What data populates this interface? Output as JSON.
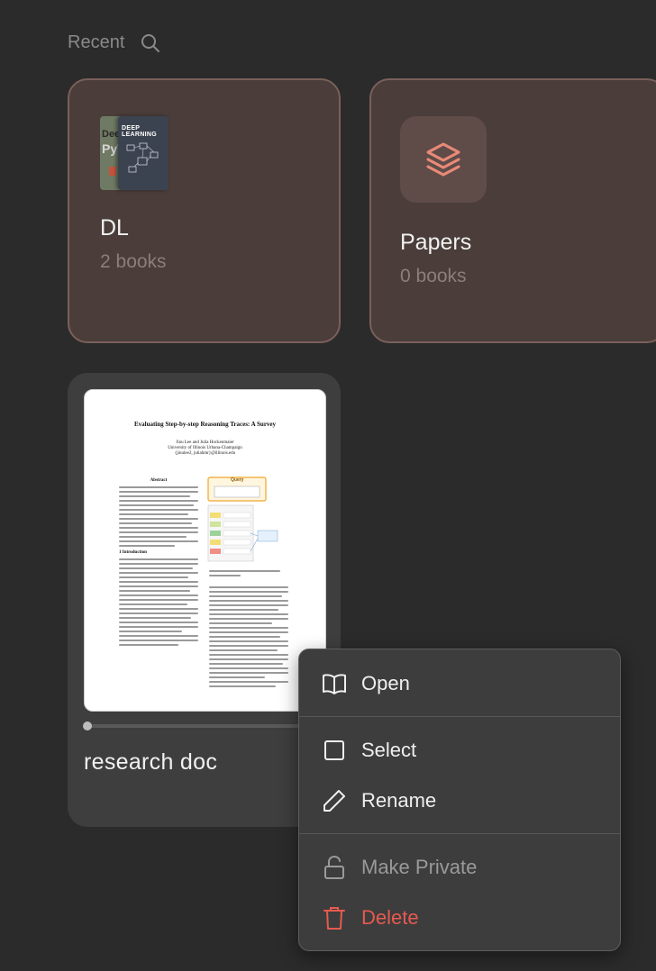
{
  "header": {
    "title": "Recent",
    "search_icon": "search-icon"
  },
  "collections": [
    {
      "title": "DL",
      "count": "2 books",
      "cover_texts": [
        "Deep L",
        "PyTo",
        "DEEP LEARNING"
      ]
    },
    {
      "title": "Papers",
      "count": "0 books",
      "icon": "layers-icon"
    }
  ],
  "document": {
    "title": "research doc",
    "reading_progress": 0,
    "preview": {
      "paper_title": "Evaluating Step-by-step Reasoning Traces: A Survey",
      "authors": "Jinu Lee  and  Julia Hockenmaier",
      "affiliation": "University of Illinois Urbana-Champaign",
      "emails": "{jinulee2, juliahmr}@illinois.edu",
      "abstract_heading": "Abstract",
      "intro_heading": "1   Introduction",
      "figure_label": "Query"
    }
  },
  "context_menu": {
    "items": [
      {
        "label": "Open",
        "icon": "book-open-icon"
      },
      {
        "label": "Select",
        "icon": "checkbox-icon"
      },
      {
        "label": "Rename",
        "icon": "pencil-icon"
      },
      {
        "label": "Make Private",
        "icon": "unlock-icon"
      },
      {
        "label": "Delete",
        "icon": "trash-icon"
      }
    ]
  },
  "colors": {
    "background": "#2b2b2b",
    "collection_card": "#4a3d3a",
    "accent": "#e98a78",
    "danger": "#e65a50"
  }
}
